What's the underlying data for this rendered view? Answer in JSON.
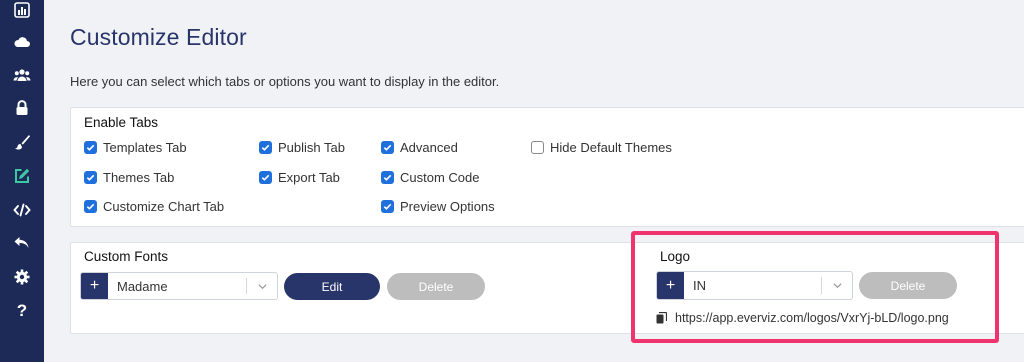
{
  "page": {
    "title": "Customize Editor",
    "description": "Here you can select which tabs or options you want to display in the editor."
  },
  "sidebar": {
    "icons": [
      "bar-chart-icon",
      "cloud-icon",
      "users-icon",
      "lock-icon",
      "brush-icon",
      "edit-icon",
      "code-icon",
      "undo-icon",
      "gear-icon",
      "help-icon"
    ],
    "active": "edit-icon",
    "help_glyph": "?"
  },
  "tabs_panel": {
    "heading": "Enable Tabs",
    "options": [
      {
        "label": "Templates Tab",
        "checked": true
      },
      {
        "label": "Themes Tab",
        "checked": true
      },
      {
        "label": "Customize Chart Tab",
        "checked": true
      },
      {
        "label": "Publish Tab",
        "checked": true
      },
      {
        "label": "Export Tab",
        "checked": true
      },
      {
        "label": "Advanced",
        "checked": true
      },
      {
        "label": "Custom Code",
        "checked": true
      },
      {
        "label": "Preview Options",
        "checked": true
      },
      {
        "label": "Hide Default Themes",
        "checked": false
      }
    ]
  },
  "fonts_panel": {
    "heading": "Custom Fonts",
    "plus_label": "+",
    "selected_font": "Madame",
    "edit_label": "Edit",
    "delete_label": "Delete"
  },
  "logo_panel": {
    "heading": "Logo",
    "plus_label": "+",
    "selected_logo": "IN",
    "delete_label": "Delete",
    "url": "https://app.everviz.com/logos/VxrYj-bLD/logo.png"
  },
  "colors": {
    "sidebar": "#1d2a57",
    "primary": "#28356a",
    "checkbox": "#1f6fdc",
    "highlight": "#f0336c",
    "active_icon": "#3dc7a4"
  }
}
